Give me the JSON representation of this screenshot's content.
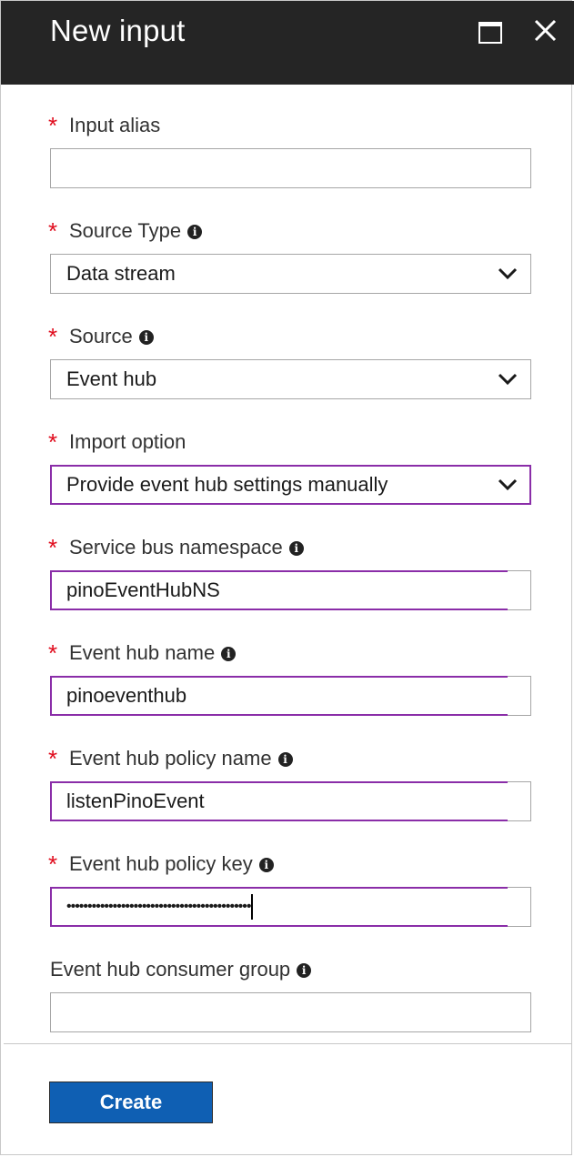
{
  "header": {
    "title": "New input",
    "maximize_icon": "maximize-icon",
    "close_icon": "close-icon",
    "background": "#252525"
  },
  "form": {
    "input_alias": {
      "label": "Input alias",
      "required": "*",
      "value": ""
    },
    "source_type": {
      "label": "Source Type",
      "required": "*",
      "value": "Data stream",
      "info_icon": "info-icon"
    },
    "source": {
      "label": "Source",
      "required": "*",
      "value": "Event hub",
      "info_icon": "info-icon"
    },
    "import_option": {
      "label": "Import option",
      "required": "*",
      "value": "Provide event hub settings manually"
    },
    "service_bus_namespace": {
      "label": "Service bus namespace",
      "required": "*",
      "value": "pinoEventHubNS",
      "info_icon": "info-icon"
    },
    "event_hub_name": {
      "label": "Event hub name",
      "required": "*",
      "value": "pinoeventhub",
      "info_icon": "info-icon"
    },
    "event_hub_policy_name": {
      "label": "Event hub policy name",
      "required": "*",
      "value": "listenPinoEvent",
      "info_icon": "info-icon"
    },
    "event_hub_policy_key": {
      "label": "Event hub policy key",
      "required": "*",
      "value": "••••••••••••••••••••••••••••••••••••••••••••",
      "info_icon": "info-icon"
    },
    "event_hub_consumer_group": {
      "label": "Event hub consumer group",
      "value": "",
      "info_icon": "info-icon"
    }
  },
  "footer": {
    "create_label": "Create",
    "create_color": "#0f5fb3"
  },
  "colors": {
    "required_asterisk": "#e00b1c",
    "focus_border": "#8a2da8"
  }
}
